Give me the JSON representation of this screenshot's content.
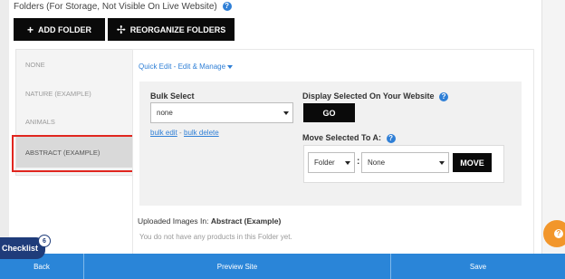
{
  "header": {
    "section_title": "Folders (For Storage, Not Visible On Live Website)",
    "help_icon": "?"
  },
  "toolbar": {
    "add_folder_label": "ADD FOLDER",
    "reorganize_label": "REORGANIZE FOLDERS",
    "plus_icon": "+",
    "move_icon": "✢"
  },
  "folders": [
    {
      "label": "NONE"
    },
    {
      "label": "NATURE (EXAMPLE)"
    },
    {
      "label": "ANIMALS"
    },
    {
      "label": "ABSTRACT (EXAMPLE)"
    }
  ],
  "quick_edit": {
    "label": "Quick Edit - Edit & Manage"
  },
  "bulk": {
    "title": "Bulk Select",
    "select_value": "none",
    "bulk_edit": "bulk edit",
    "separator": "-",
    "bulk_delete": "bulk delete"
  },
  "display": {
    "title": "Display Selected On Your Website",
    "help_icon": "?",
    "go_label": "GO"
  },
  "move": {
    "title": "Move Selected To A:",
    "help_icon": "?",
    "type_value": "Folder",
    "colon": ":",
    "target_value": "None",
    "move_label": "MOVE"
  },
  "uploaded": {
    "prefix": "Uploaded Images In:",
    "folder_name": "Abstract (Example)",
    "empty_text": "You do not have any products in this Folder yet."
  },
  "bottom_bar": {
    "back_label": "Back",
    "preview_label": "Preview Site",
    "save_label": "Save"
  },
  "checklist": {
    "label": "Checklist",
    "badge": "6"
  },
  "colors": {
    "accent_blue": "#2a85d8",
    "link_blue": "#2f7fd6",
    "highlight_red": "#e0261f",
    "button_black": "#0a0a0a",
    "checklist_navy": "#1f3c7a",
    "help_orange": "#f2962b"
  }
}
